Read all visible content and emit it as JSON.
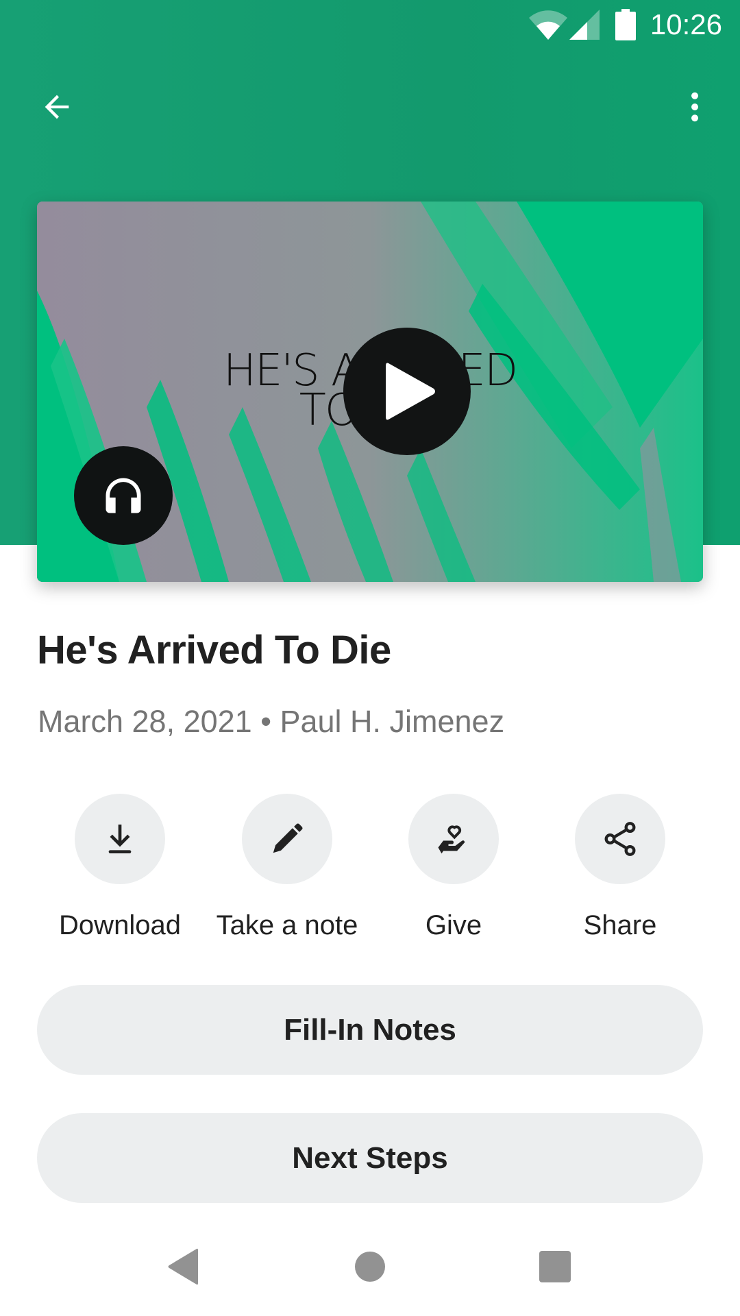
{
  "status_bar": {
    "time": "10:26",
    "icons": [
      "wifi-icon",
      "cellular-signal-icon",
      "battery-icon"
    ]
  },
  "toolbar": {
    "back_icon": "arrow-left-icon",
    "menu_icon": "more-vertical-icon"
  },
  "media_card": {
    "artwork_text_line1": "HE'S ARRIVED",
    "artwork_text_line2": "TO DIE",
    "play_icon": "play-icon",
    "audio_icon": "headphones-icon"
  },
  "sermon": {
    "title": "He's Arrived To Die",
    "meta": "March 28, 2021 • Paul H. Jimenez"
  },
  "actions": [
    {
      "label": "Download",
      "icon": "download-icon"
    },
    {
      "label": "Take a note",
      "icon": "pencil-icon"
    },
    {
      "label": "Give",
      "icon": "give-heart-hand-icon"
    },
    {
      "label": "Share",
      "icon": "share-icon"
    }
  ],
  "buttons": {
    "fill_in_notes": "Fill-In Notes",
    "next_steps": "Next Steps"
  },
  "nav_bar": {
    "back": "nav-back-icon",
    "home": "nav-home-icon",
    "recents": "nav-recents-icon"
  },
  "colors": {
    "header_green": "#149c6f",
    "artwork_green": "#00c07f",
    "button_bg": "#eceeef",
    "text_primary": "#212121",
    "text_secondary": "#757575"
  }
}
